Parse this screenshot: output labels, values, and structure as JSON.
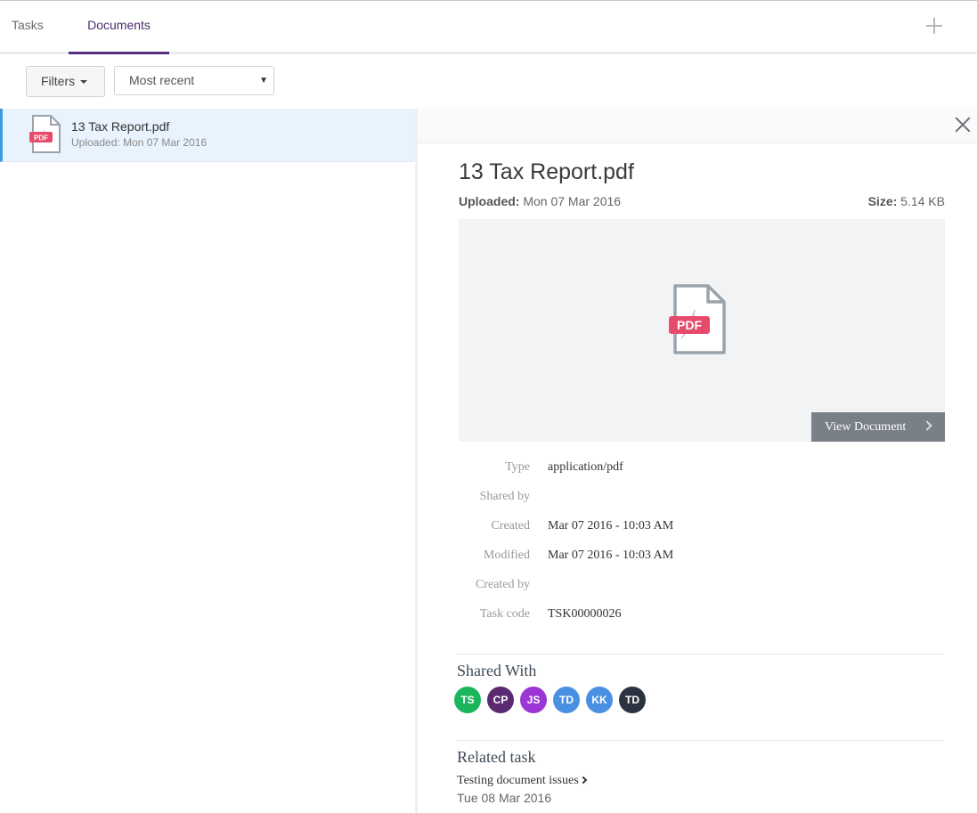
{
  "tabs": [
    {
      "label": "Tasks"
    },
    {
      "label": "Documents"
    }
  ],
  "toolbar": {
    "filters_label": "Filters",
    "sort_value": "Most recent"
  },
  "list": {
    "items": [
      {
        "title": "13 Tax Report.pdf",
        "uploaded_label": "Uploaded:",
        "uploaded_value": "Mon 07 Mar 2016"
      }
    ]
  },
  "detail": {
    "title": "13 Tax Report.pdf",
    "uploaded_label": "Uploaded:",
    "uploaded_value": "Mon 07 Mar 2016",
    "size_label": "Size:",
    "size_value": "5.14 KB",
    "file_badge": "PDF",
    "view_button": "View Document",
    "properties": [
      {
        "label": "Type",
        "value": "application/pdf"
      },
      {
        "label": "Shared by",
        "value": ""
      },
      {
        "label": "Created",
        "value": "Mar 07 2016 - 10:03 AM"
      },
      {
        "label": "Modified",
        "value": "Mar 07 2016 - 10:03 AM"
      },
      {
        "label": "Created by",
        "value": ""
      },
      {
        "label": "Task code",
        "value": "TSK00000026"
      }
    ],
    "shared_with_title": "Shared With",
    "shared_with": [
      {
        "initials": "TS",
        "color": "#1bb55c"
      },
      {
        "initials": "CP",
        "color": "#5a2a72"
      },
      {
        "initials": "JS",
        "color": "#9b35d6"
      },
      {
        "initials": "TD",
        "color": "#4a90e2"
      },
      {
        "initials": "KK",
        "color": "#4a90e2"
      },
      {
        "initials": "TD",
        "color": "#2c3340"
      }
    ],
    "related_task_title": "Related task",
    "related_task": {
      "name": "Testing document issues",
      "date": "Tue 08 Mar 2016"
    }
  },
  "colors": {
    "accent": "#5a2d82",
    "selection": "#e8f3fd",
    "pdf_badge": "#e84a6a"
  }
}
